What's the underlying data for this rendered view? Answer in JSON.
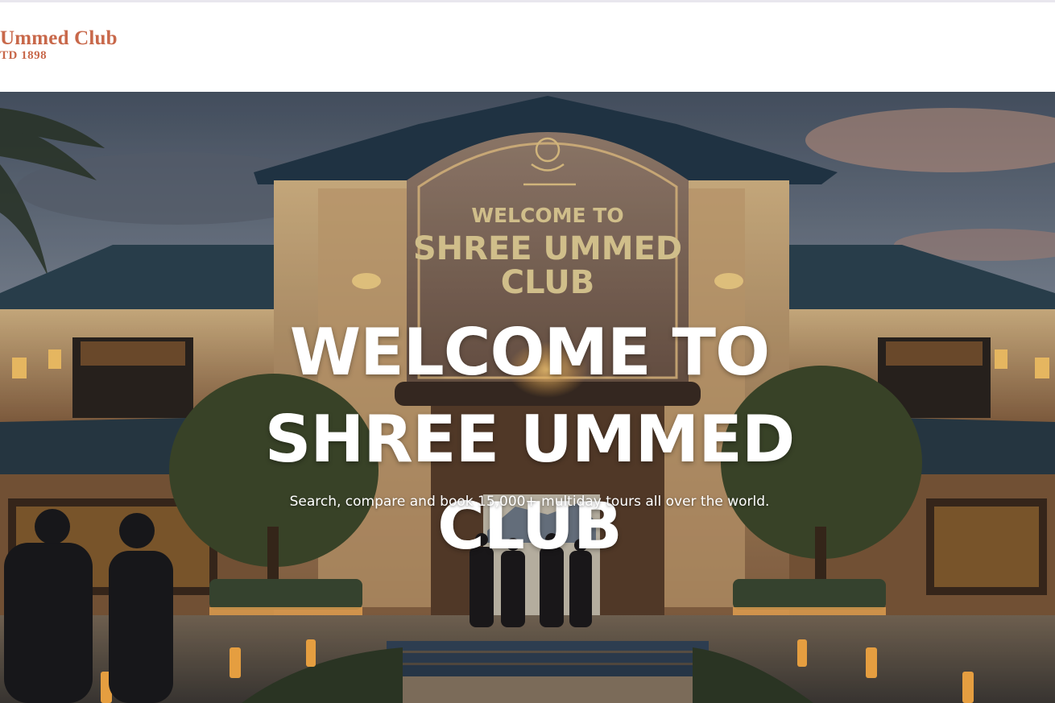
{
  "header": {
    "logo_name": "Ummed Club",
    "logo_est": "TD 1898",
    "brand_color": "#c8684a"
  },
  "hero": {
    "title": "WELCOME TO SHREE UMMED CLUB",
    "subtitle": "Search, compare and book 15,000+ multiday tours all over the world.",
    "sign_line1": "WELCOME TO",
    "sign_line2": "SHREE UMMED",
    "sign_line3": "CLUB"
  }
}
